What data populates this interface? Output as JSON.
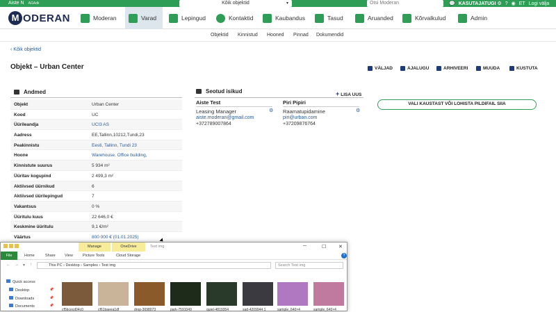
{
  "topbar": {
    "user": "Aiste N",
    "user_tag": "AGAdk",
    "object_select": "Kõik objektid",
    "search_placeholder": "Otsi Moderan",
    "support": "KASUTAJATUGI",
    "lang": "ET",
    "logout": "Logi välja"
  },
  "logo": {
    "letter": "M",
    "text": "ODERAN"
  },
  "nav": [
    {
      "label": "Moderan",
      "icon": "building-icon",
      "active": false
    },
    {
      "label": "Varad",
      "icon": "building-icon",
      "active": true
    },
    {
      "label": "Lepingud",
      "icon": "document-icon",
      "active": false
    },
    {
      "label": "Kontaktid",
      "icon": "contacts-icon",
      "active": false
    },
    {
      "label": "Kaubandus",
      "icon": "cart-icon",
      "active": false
    },
    {
      "label": "Tasud",
      "icon": "money-icon",
      "active": false
    },
    {
      "label": "Aruanded",
      "icon": "chart-icon",
      "active": false
    },
    {
      "label": "Kõrvalkulud",
      "icon": "tools-icon",
      "active": false
    },
    {
      "label": "Admin",
      "icon": "sitemap-icon",
      "active": false
    }
  ],
  "subnav": [
    "Objektid",
    "Kinnistud",
    "Hooned",
    "Pinnad",
    "Dokumendid"
  ],
  "back_link": "‹ Kõik objektid",
  "page_title": "Objekt – Urban Center",
  "actions": [
    "VÄLJAD",
    "AJALUGU",
    "ARHIVEERI",
    "MUUDA",
    "KUSTUTA"
  ],
  "andmed": {
    "title": "Andmed",
    "rows": [
      {
        "k": "Objekt",
        "v": "Urban Center",
        "link": false
      },
      {
        "k": "Kood",
        "v": "UC",
        "link": false
      },
      {
        "k": "Üürileandja",
        "v": "UCI3 AS",
        "link": true
      },
      {
        "k": "Aadress",
        "v": "EE,Tallinn,10212,Tundi,23",
        "link": false
      },
      {
        "k": "Peakinnistu",
        "v": "Eesti, Tallinn, Tundi 23",
        "link": true
      },
      {
        "k": "Hoone",
        "v": "Warehouse, Office building,",
        "link": true
      },
      {
        "k": "Kinnistute suurus",
        "v": "5 934 m²",
        "link": false
      },
      {
        "k": "Üüritav kogupind",
        "v": "2 499,3 m²",
        "link": false
      },
      {
        "k": "Aktiivsed üürnikud",
        "v": "6",
        "link": false
      },
      {
        "k": "Aktiivsed üürilepingud",
        "v": "7",
        "link": false
      },
      {
        "k": "Vakantsus",
        "v": "0 %",
        "link": false
      },
      {
        "k": "Üüritulu kuus",
        "v": "22 646,0 €",
        "link": false
      },
      {
        "k": "Keskmine üüritulu",
        "v": "9,1 €/m²",
        "link": false
      },
      {
        "k": "Väärtus",
        "v": "800 000 € (01.01.2025)",
        "link": true
      }
    ]
  },
  "seotud": {
    "title": "Seotud isikud",
    "add_label": "LISA UUS",
    "people": [
      {
        "name": "Aiste Test",
        "role": "Leasing Manager",
        "email": "aiste.moderan@gmail.com",
        "phone": "+372789007864"
      },
      {
        "name": "Piri Pipiri",
        "role": "Raamatupidamine",
        "email": "piri@urban.com",
        "phone": "+37209876764"
      }
    ]
  },
  "dropzone": "VALI KAUSTAST VÕI LOHISTA PILDIFAIL SIIA",
  "explorer": {
    "manage": "Manage",
    "onedrive": "OneDrive",
    "title": "Test img",
    "tabs": [
      "File",
      "Home",
      "Share",
      "View",
      "Picture Tools",
      "Cloud Storage"
    ],
    "path": [
      "This PC",
      "Desktop",
      "Samples",
      "Test img"
    ],
    "search_placeholder": "Search Test img",
    "sidebar": [
      "Quick access",
      "Desktop",
      "Downloads",
      "Documents"
    ],
    "files": [
      "cf5bcecd04c0",
      "cf61baeea1df",
      "drop-3698073",
      "park-7591049",
      "quiet-4819354",
      "sad-4209944 1",
      "sample_640×4",
      "sample_640×4"
    ],
    "thumb_colors": [
      "#7a5a3a",
      "#c9b49a",
      "#8a5a2a",
      "#1e2a1a",
      "#2a3a2a",
      "#3a3a40",
      "#b078c0",
      "#c07aa0"
    ]
  }
}
